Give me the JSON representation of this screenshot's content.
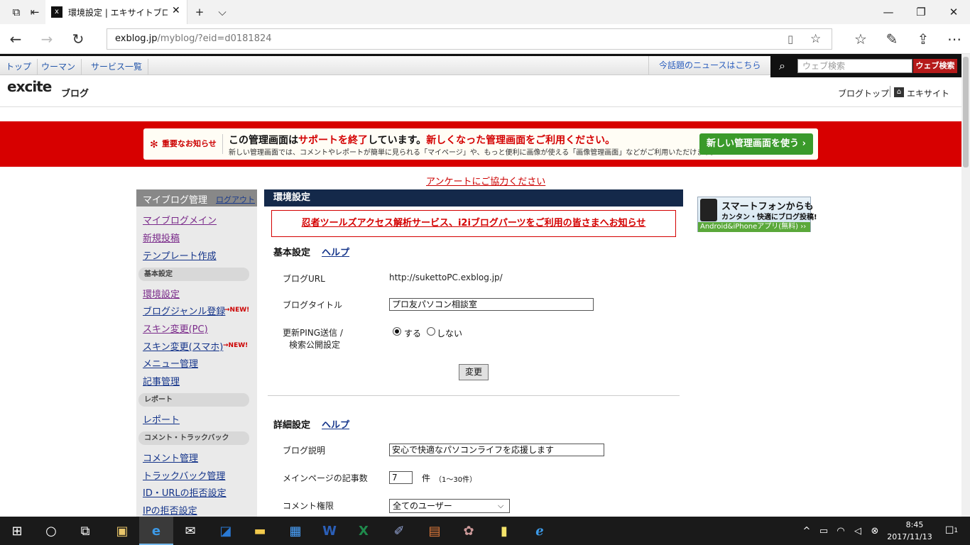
{
  "browser": {
    "tab_title": "環境設定 | エキサイトブログ",
    "url_host": "exblog.jp",
    "url_path": "/myblog/?eid=d0181824",
    "icons": [
      "back-arrow-icon",
      "forward-arrow-icon",
      "refresh-icon",
      "reading-view-icon",
      "favorite-star-icon",
      "favorites-hub-icon",
      "pen-icon",
      "share-icon",
      "more-icon"
    ]
  },
  "global_nav": {
    "items": [
      "トップ",
      "ウーマン",
      "サービス一覧"
    ],
    "news_link": "今話題のニュースはこちら",
    "search_placeholder": "ウェブ検索",
    "search_button": "ウェブ検索"
  },
  "header": {
    "logo": "excite",
    "logo_sub": "ブログ",
    "blog_top": "ブログトップ",
    "excite_site": "エキサイト"
  },
  "notice": {
    "tag": "重要なお知らせ",
    "main_prefix": "この管理画面は",
    "main_red1": "サポートを終了",
    "main_mid": "しています。",
    "main_red2": "新しくなった管理画面をご利用ください。",
    "sub": "新しい管理画面では、コメントやレポートが簡単に見られる「マイページ」や、もっと便利に画像が使える「画像管理画面」などがご利用いただけます。",
    "button": "新しい管理画面を使う ›"
  },
  "survey_link": "アンケートにご協力ください",
  "sidebar": {
    "title": "マイブログ管理",
    "logout": "ログアウト",
    "links_top": [
      "マイブログメイン",
      "新規投稿",
      "テンプレート作成"
    ],
    "section_basic": "基本設定",
    "links_basic": [
      "環境設定",
      "ブログジャンル登録",
      "スキン変更(PC)",
      "スキン変更(スマホ)",
      "メニュー管理",
      "記事管理"
    ],
    "new_label": "NEW!",
    "section_report": "レポート",
    "links_report": [
      "レポート"
    ],
    "section_comment": "コメント・トラックバック",
    "links_comment": [
      "コメント管理",
      "トラックバック管理",
      "ID・URLの拒否設定",
      "IPの拒否設定"
    ]
  },
  "main": {
    "heading": "環境設定",
    "ninja_notice": "忍者ツールズアクセス解析サービス、i2iブログパーツをご利用の皆さまへお知らせ",
    "basic": {
      "title": "基本設定",
      "help": "ヘルプ",
      "blog_url_label": "ブログURL",
      "blog_url_value": "http://sukettoPC.exblog.jp/",
      "blog_title_label": "ブログタイトル",
      "blog_title_value": "プロ友パソコン相談室",
      "ping_label_1": "更新PING送信 /",
      "ping_label_2": "検索公開設定",
      "radio_yes": "する",
      "radio_no": "しない",
      "change_button": "変更"
    },
    "detail": {
      "title": "詳細設定",
      "help": "ヘルプ",
      "desc_label": "ブログ説明",
      "desc_value": "安心で快適なパソコンライフを応援します",
      "posts_label": "メインページの記事数",
      "posts_value": "7",
      "posts_unit": "件",
      "posts_range": "（1〜30件）",
      "comment_label": "コメント権限",
      "comment_value": "全てのユーザー"
    }
  },
  "ad": {
    "line1": "スマートフォンからも",
    "line2": "カンタン・快適にブログ投稿!",
    "bar": "Android&iPhoneアプリ(無料) ››"
  },
  "taskbar": {
    "time": "8:45",
    "date": "2017/11/13",
    "notification_count": "1"
  }
}
